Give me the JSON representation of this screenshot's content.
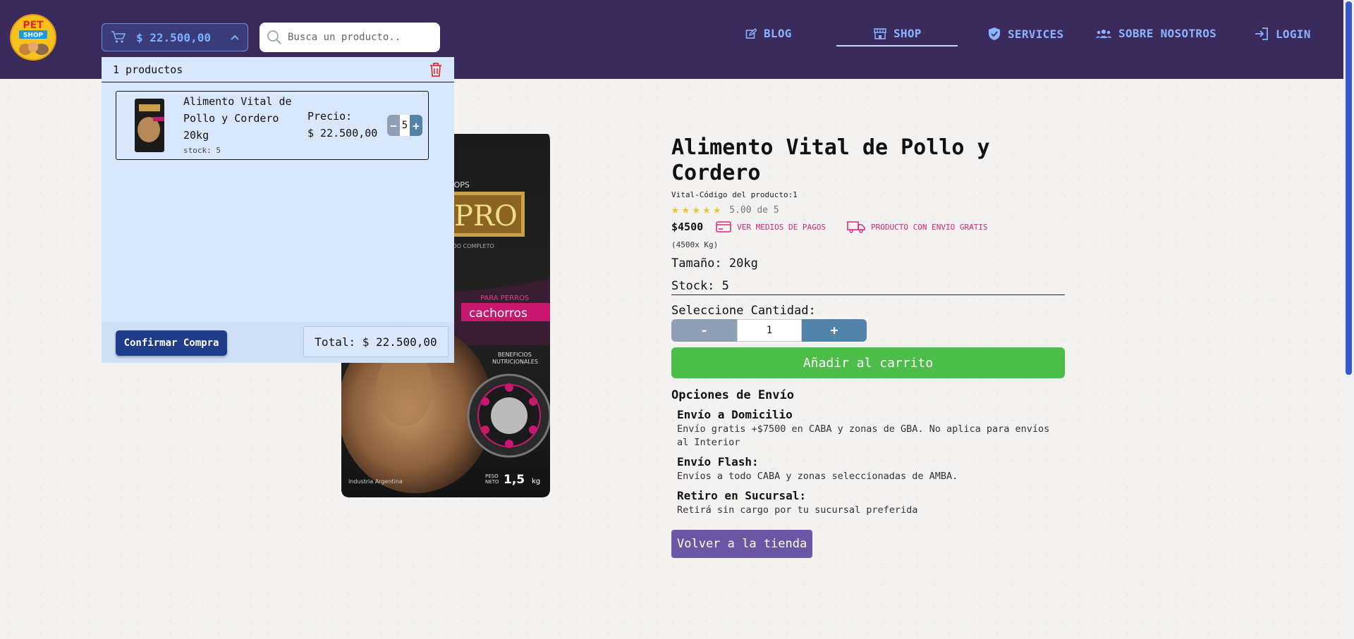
{
  "nav": {
    "logo_top": "PET",
    "logo_bottom": "SHOP",
    "cart_total": "$ 22.500,00",
    "search_placeholder": "Busca un producto..",
    "links": [
      {
        "label": "BLOG",
        "icon": "edit-icon"
      },
      {
        "label": "SHOP",
        "icon": "store-icon",
        "active": true
      },
      {
        "label": "SERVICES",
        "icon": "shield-icon"
      },
      {
        "label": "SOBRE NOSOTROS",
        "icon": "users-icon"
      },
      {
        "label": "LOGIN",
        "icon": "login-icon"
      }
    ]
  },
  "cart": {
    "count_label": "1 productos",
    "items": [
      {
        "name": "Alimento Vital de Pollo y Cordero 20kg",
        "price_label": "Precio:",
        "price": "$ 22.500,00",
        "quantity": "5",
        "stock": "stock: 5"
      }
    ],
    "confirm_label": "Confirmar Compra",
    "total_label": "Total: $ 22.500,00"
  },
  "product": {
    "title": "Alimento Vital de Pollo y Cordero",
    "code": "Vital-Código del producto:1",
    "rating": 5,
    "rating_text": "5.00 de 5",
    "price": "$4500",
    "payment_link": "VER MEDIOS DE PAGOS",
    "free_shipping": "PRODUCTO CON ENVIO GRATIS",
    "per_kg": "(4500x Kg)",
    "size": "Tamaño: 20kg",
    "stock": "Stock: 5",
    "qty_label": "Seleccione Cantidad:",
    "qty_minus": "-",
    "qty_value": "1",
    "qty_plus": "+",
    "add_to_cart": "Añadir al carrito",
    "image_texts": {
      "brand_partial": "ROPS",
      "logo": "PRO",
      "subtitle": "ADO COMPLETO",
      "para_perros": "PARA PERROS",
      "cachorros": "cachorros",
      "beneficios": "BENEFICIOS",
      "nutricionales": "NUTRICIONALES",
      "origin": "Industria Argentina",
      "peso_label1": "PESO",
      "peso_label2": "NETO",
      "peso_value": "1,5",
      "peso_unit": "kg"
    }
  },
  "shipping": {
    "heading": "Opciones de Envío",
    "options": [
      {
        "title": "Envío a Domicilio",
        "desc": "Envío gratis +$7500 en CABA y zonas de GBA. No aplica para envíos al Interior"
      },
      {
        "title": "Envío Flash:",
        "desc": "Envíos a todo CABA y zonas seleccionadas de AMBA."
      },
      {
        "title": "Retiro en Sucursal:",
        "desc": "Retirá sin cargo por tu sucursal preferida"
      }
    ]
  },
  "back_button": "Volver a la tienda",
  "colors": {
    "navbar": "#3b2a5c",
    "nav_link": "#8ab4ff",
    "add_to_cart": "#4dbd4a",
    "back_button": "#6b56a6",
    "accent_pink": "#d6277c",
    "star": "#f2c230",
    "cart_panel": "#d8e7fb",
    "confirm": "#1f3d8a"
  }
}
